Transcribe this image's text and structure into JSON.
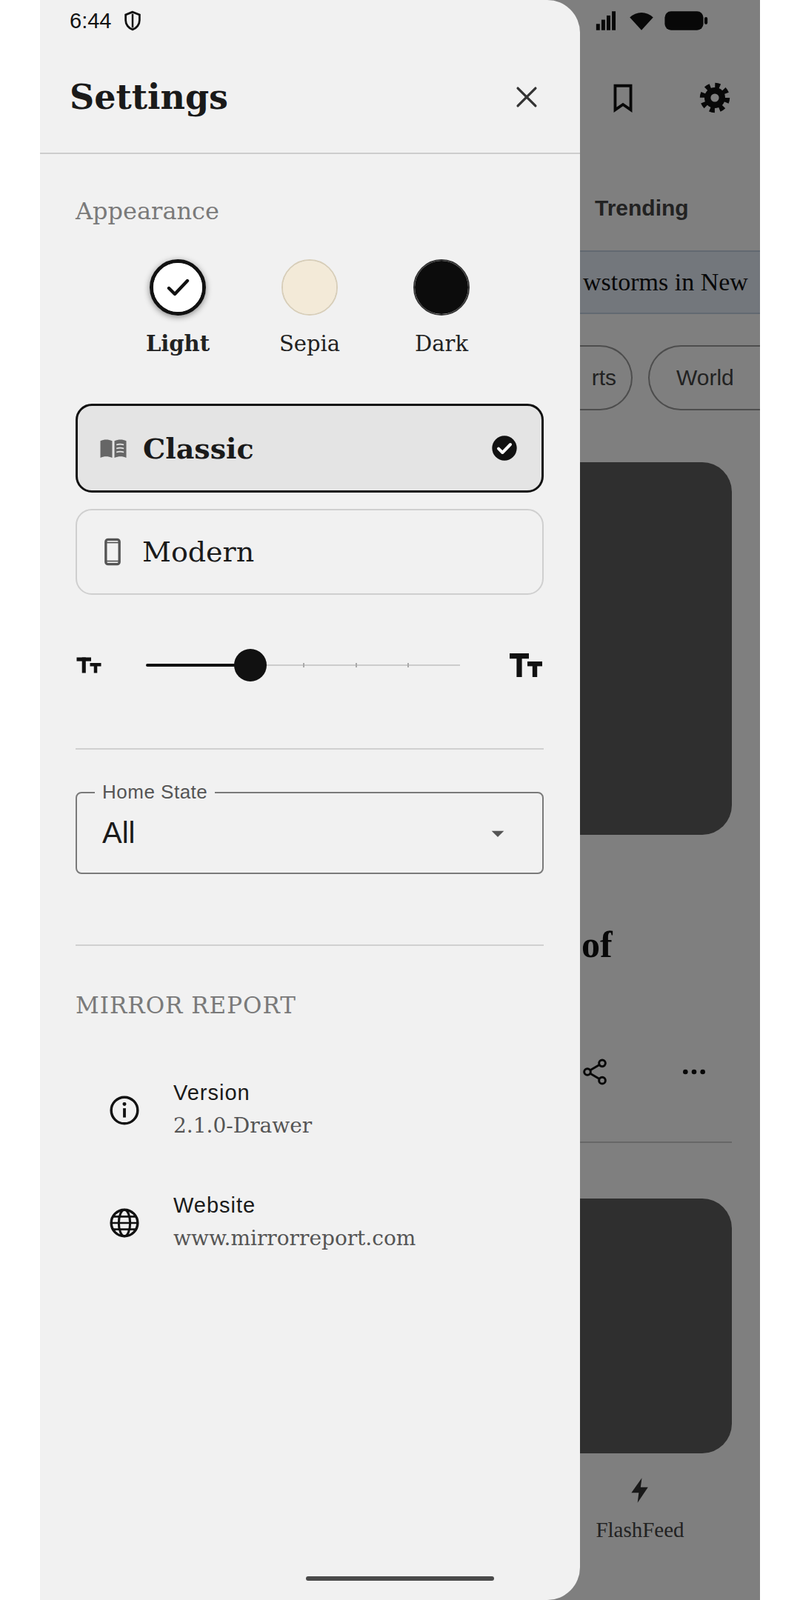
{
  "status_bar": {
    "time": "6:44"
  },
  "drawer": {
    "title": "Settings"
  },
  "appearance": {
    "heading": "Appearance",
    "themes": [
      {
        "label": "Light",
        "selected": true,
        "color": "#ffffff"
      },
      {
        "label": "Sepia",
        "selected": false,
        "color": "#f3ead8"
      },
      {
        "label": "Dark",
        "selected": false,
        "color": "#0c0c0c"
      }
    ],
    "layouts": [
      {
        "label": "Classic",
        "selected": true
      },
      {
        "label": "Modern",
        "selected": false
      }
    ],
    "text_size": {
      "level": 0.333
    }
  },
  "home_state": {
    "label": "Home State",
    "value": "All"
  },
  "about": {
    "heading": "MIRROR REPORT",
    "items": [
      {
        "label": "Version",
        "value": "2.1.0-Drawer"
      },
      {
        "label": "Website",
        "value": "www.mirrorreport.com"
      }
    ]
  },
  "background": {
    "tab": "Trending",
    "banner": "wstorms in New",
    "chips": [
      "rts",
      "World"
    ],
    "headline": "of",
    "nav": "FlashFeed"
  }
}
